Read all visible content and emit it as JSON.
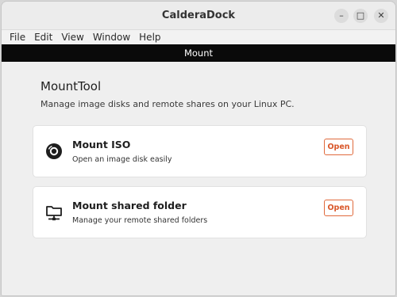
{
  "window": {
    "title": "CalderaDock"
  },
  "window_controls": {
    "minimize": "–",
    "maximize": "□",
    "close": "✕"
  },
  "menubar": [
    "File",
    "Edit",
    "View",
    "Window",
    "Help"
  ],
  "header": {
    "title": "Mount"
  },
  "app": {
    "title": "MountTool",
    "subtitle": "Manage image disks and remote shares on your Linux PC."
  },
  "cards": [
    {
      "title": "Mount ISO",
      "description": "Open an image disk easily",
      "button": "Open",
      "icon": "disc-icon"
    },
    {
      "title": "Mount shared folder",
      "description": "Manage your remote shared folders",
      "button": "Open",
      "icon": "network-folder-icon"
    }
  ],
  "colors": {
    "accent": "#e06a3c",
    "header_bg": "#0a0a0a"
  }
}
